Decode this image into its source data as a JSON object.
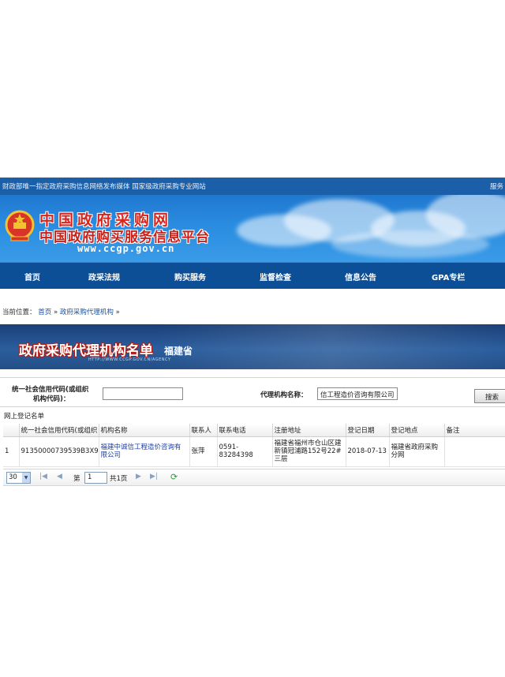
{
  "topbar": {
    "left_text": "财政部唯一指定政府采购信息网络发布媒体  国家级政府采购专业网站",
    "right_text": "服务"
  },
  "banner": {
    "title_main": "中国政府采购网",
    "title_sub": "中国政府购买服务信息平台",
    "url": "www.ccgp.gov.cn"
  },
  "nav": {
    "items": [
      "首页",
      "政采法规",
      "购买服务",
      "监督检查",
      "信息公告",
      "GPA专栏"
    ]
  },
  "breadcrumb": {
    "prefix": "当前位置：",
    "home": "首页",
    "sep": "»",
    "current": "政府采购代理机构",
    "trail": "»"
  },
  "header_banner": {
    "title": "政府采购代理机构名单",
    "province": "福建省",
    "url_caption": "HTTP://WWW.CCGP.GOV.CN/AGENCY"
  },
  "search": {
    "credit_code_label_line1": "统一社会信用代码(或组织",
    "credit_code_label_line2": "机构代码)：",
    "credit_code_value": "",
    "agency_name_label": "代理机构名称：",
    "agency_name_value": "信工程造价咨询有限公司",
    "search_button": "搜索"
  },
  "register_list_label": "网上登记名单",
  "table": {
    "columns": [
      "",
      "统一社会信用代码(或组织",
      "机构名称",
      "联系人",
      "联系电话",
      "注册地址",
      "登记日期",
      "登记地点",
      "备注"
    ],
    "rows": [
      {
        "index": "1",
        "credit_code": "91350000739539B3X9",
        "name": "福建中诚信工程造价咨询有限公司",
        "contact": "张萍",
        "phone": "0591-83284398",
        "address": "福建省福州市仓山区建新镇冠浦路152号22#三层",
        "date": "2018-07-13",
        "location": "福建省政府采购分网",
        "note": ""
      }
    ]
  },
  "pager": {
    "page_size": "30",
    "page_prefix": "第",
    "page_value": "1",
    "page_suffix": "共1页"
  },
  "colors": {
    "topbar": "#1a5fa8",
    "nav": "#0c4f97",
    "title_red": "#d7261e",
    "link": "#1d3fa3"
  }
}
